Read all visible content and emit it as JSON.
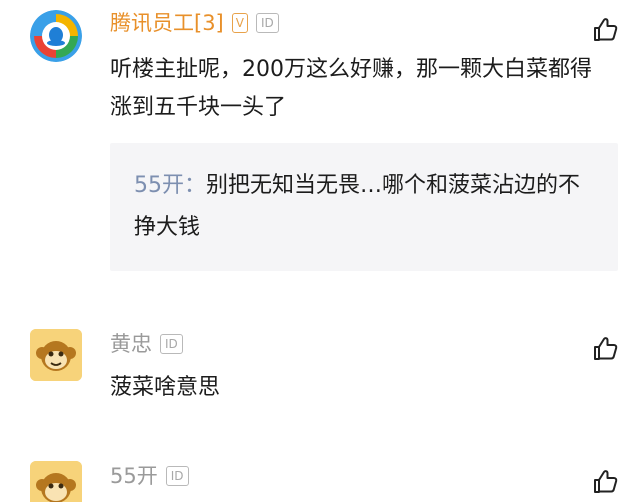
{
  "comments": [
    {
      "username": "腾讯员工[3]",
      "badges": [
        "V",
        "ID"
      ],
      "text": "听楼主扯呢，200万这么好赚，那一颗大白菜都得涨到五千块一头了",
      "reply": {
        "name": "55开：",
        "text": "别把无知当无畏…哪个和菠菜沾边的不挣大钱"
      }
    },
    {
      "username": "黄忠",
      "badges": [
        "ID"
      ],
      "text": "菠菜啥意思"
    },
    {
      "username": "55开",
      "badges": [
        "ID"
      ]
    }
  ],
  "icons": {
    "like": "thumbs-up-icon",
    "avatar_tencent": "tencent-news-logo",
    "avatar_monkey": "monkey-avatar"
  },
  "colors": {
    "vip_name": "#e8902a",
    "normal_name": "#9a9a9a",
    "reply_name": "#7d8fb0",
    "reply_bg": "#f5f5f7"
  }
}
